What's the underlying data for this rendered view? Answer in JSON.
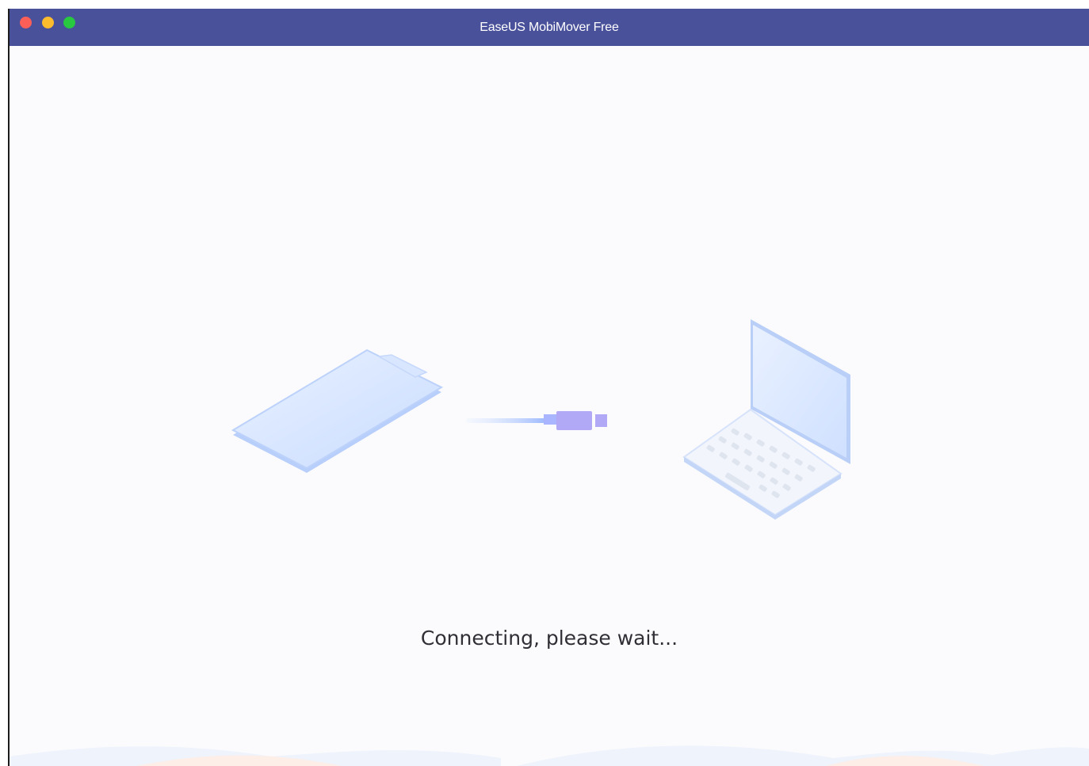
{
  "window": {
    "title": "EaseUS MobiMover Free",
    "titlebar_color": "#4a519b"
  },
  "traffic_lights": {
    "close_color": "#fc5f57",
    "minimize_color": "#fdbc2e",
    "zoom_color": "#28c840"
  },
  "main": {
    "status_text": "Connecting, please wait...",
    "illustration": {
      "left": "phone-icon",
      "middle": "usb-cable-icon",
      "right": "laptop-icon"
    }
  }
}
